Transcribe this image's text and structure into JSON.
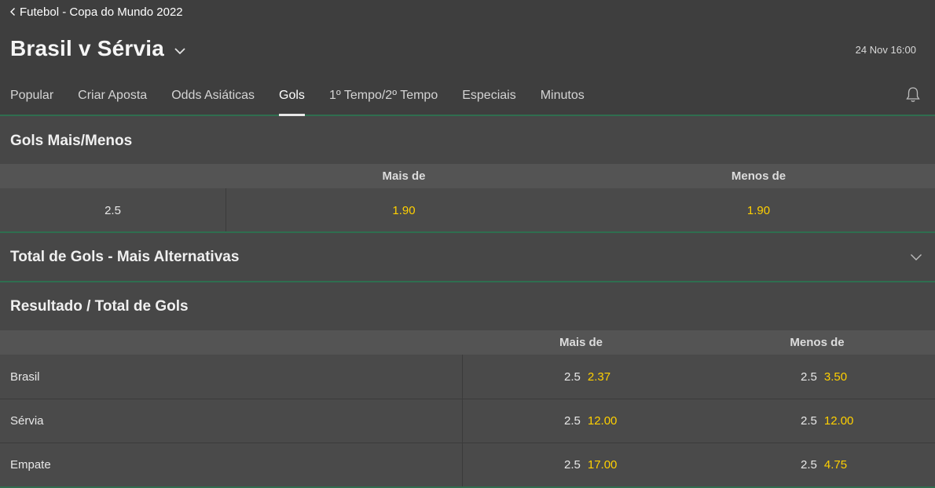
{
  "breadcrumb": {
    "label": "Futebol - Copa do Mundo 2022"
  },
  "event": {
    "title": "Brasil v Sérvia",
    "datetime": "24 Nov 16:00"
  },
  "tabs": [
    {
      "label": "Popular",
      "active": false
    },
    {
      "label": "Criar Aposta",
      "active": false
    },
    {
      "label": "Odds Asiáticas",
      "active": false
    },
    {
      "label": "Gols",
      "active": true
    },
    {
      "label": "1º Tempo/2º Tempo",
      "active": false
    },
    {
      "label": "Especiais",
      "active": false
    },
    {
      "label": "Minutos",
      "active": false
    }
  ],
  "markets": {
    "over_under": {
      "title": "Gols Mais/Menos",
      "col_over": "Mais de",
      "col_under": "Menos de",
      "row": {
        "line": "2.5",
        "over": "1.90",
        "under": "1.90"
      }
    },
    "alternatives": {
      "title": "Total de Gols - Mais Alternativas"
    },
    "result_total": {
      "title": "Resultado / Total de Gols",
      "col_over": "Mais de",
      "col_under": "Menos de",
      "rows": [
        {
          "label": "Brasil",
          "over_line": "2.5",
          "over": "2.37",
          "under_line": "2.5",
          "under": "3.50"
        },
        {
          "label": "Sérvia",
          "over_line": "2.5",
          "over": "12.00",
          "under_line": "2.5",
          "under": "12.00"
        },
        {
          "label": "Empate",
          "over_line": "2.5",
          "over": "17.00",
          "under_line": "2.5",
          "under": "4.75"
        }
      ]
    }
  },
  "icons": {
    "back": "chevron-left-icon",
    "dropdown": "chevron-down-icon",
    "bell": "bell-icon",
    "expand": "chevron-down-icon"
  },
  "colors": {
    "odds": "#ffd000",
    "accent_green": "#2f6e4f",
    "background": "#474747"
  }
}
